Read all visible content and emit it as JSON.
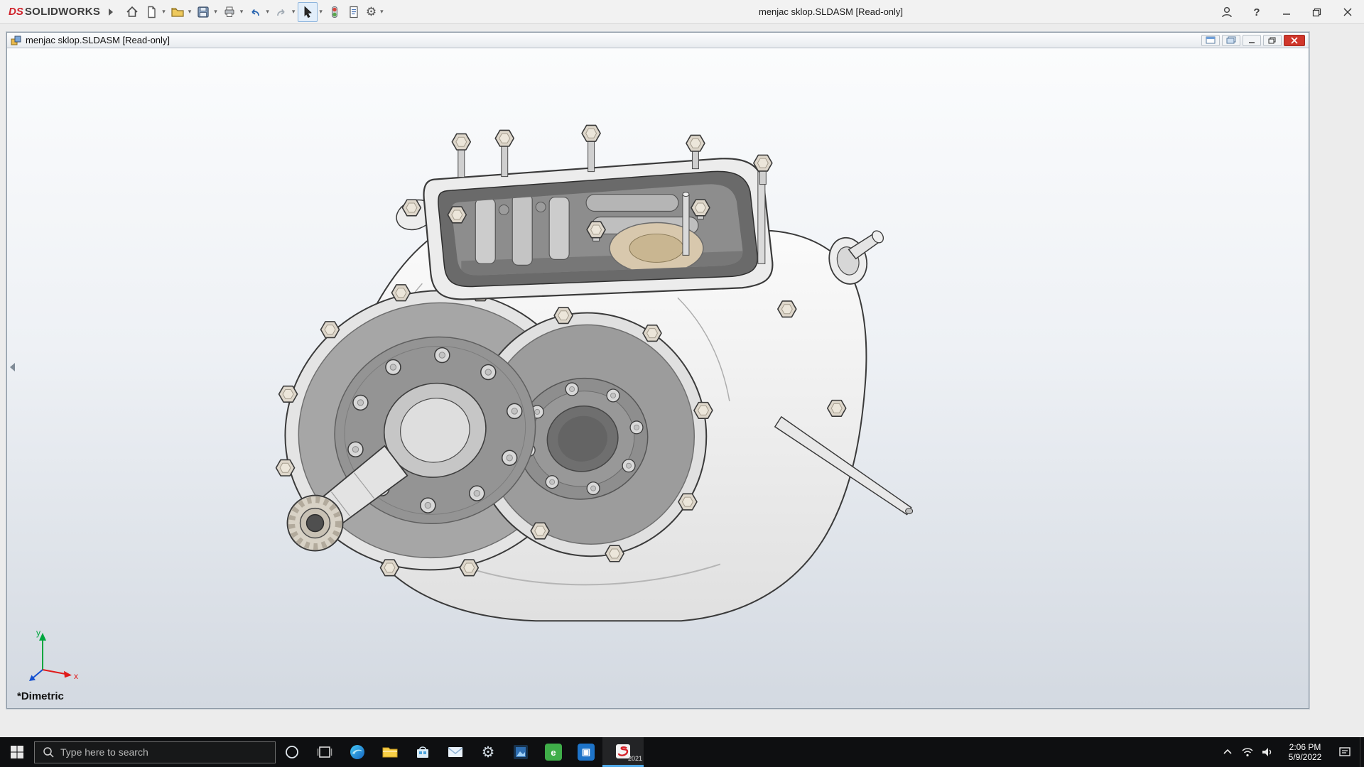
{
  "titlebar": {
    "brand_ds": "DS",
    "brand_name": "SOLIDWORKS",
    "document_title": "menjac sklop.SLDASM [Read-only]",
    "help_glyph": "?",
    "tools": [
      "home",
      "new-document",
      "open",
      "save",
      "print",
      "undo",
      "redo",
      "select",
      "rebuild",
      "file-properties",
      "options"
    ],
    "window_controls": [
      "user-account",
      "help",
      "minimize",
      "maximize",
      "close"
    ]
  },
  "document_window": {
    "title": "menjac sklop.SLDASM [Read-only]",
    "controls": [
      "tile",
      "cascade",
      "minimize",
      "restore",
      "close"
    ],
    "view_orientation": "*Dimetric",
    "triad": {
      "x_label": "x",
      "y_label": "y"
    }
  },
  "taskbar": {
    "search_placeholder": "Type here to search",
    "apps": [
      "start",
      "cortana",
      "task-view",
      "edge",
      "file-explorer",
      "store",
      "mail",
      "settings",
      "photos",
      "edrawings",
      "media",
      "solidworks"
    ],
    "solidworks_version": "2021",
    "tray": {
      "time": "2:06 PM",
      "date": "5/9/2022"
    }
  },
  "colors": {
    "brand_red": "#cf2029",
    "close_red": "#d0372c",
    "taskbar_bg": "#0e0f11",
    "accent_blue": "#4fa8e8",
    "viewport_top": "#fbfcfd",
    "viewport_bottom": "#d3d9e1"
  }
}
